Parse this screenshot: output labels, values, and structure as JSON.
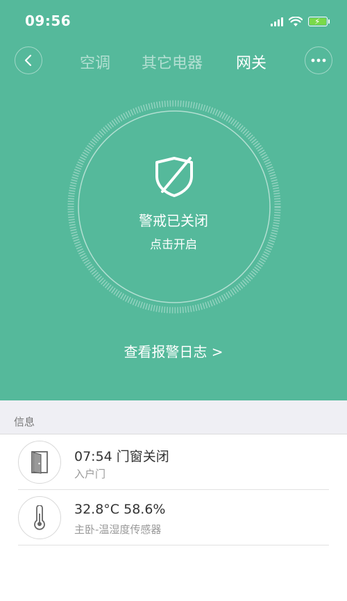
{
  "status_bar": {
    "time": "09:56"
  },
  "nav": {
    "tabs": [
      {
        "label": "空调",
        "active": false
      },
      {
        "label": "其它电器",
        "active": false
      },
      {
        "label": "网关",
        "active": true
      }
    ]
  },
  "alarm": {
    "state_label": "警戒已关闭",
    "action_label": "点击开启",
    "log_link": "查看报警日志 >"
  },
  "section": {
    "title": "信息"
  },
  "events": [
    {
      "icon": "door-icon",
      "title": "07:54 门窗关闭",
      "subtitle": "入户门"
    },
    {
      "icon": "thermometer-icon",
      "title": "32.8°C 58.6%",
      "subtitle": "主卧-温湿度传感器"
    }
  ],
  "colors": {
    "accent": "#55b99b",
    "section_bg": "#efeff4"
  }
}
